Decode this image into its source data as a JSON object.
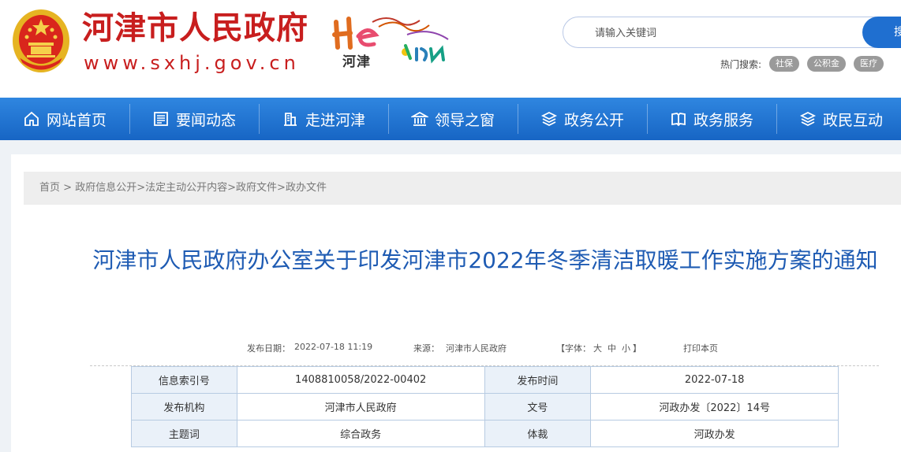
{
  "header": {
    "site_title": "河津市人民政府",
    "site_url": "www.sxhj.gov.cn",
    "logo_caption": "河津",
    "logo_wordmark": "HeJIN",
    "search": {
      "placeholder": "请输入关键词",
      "button_label": "搜索"
    },
    "hot_search": {
      "label": "热门搜索:",
      "tags": [
        "社保",
        "公积金",
        "医疗"
      ]
    }
  },
  "nav": {
    "items": [
      {
        "label": "网站首页",
        "icon": "home-icon"
      },
      {
        "label": "要闻动态",
        "icon": "news-icon"
      },
      {
        "label": "走进河津",
        "icon": "building-icon"
      },
      {
        "label": "领导之窗",
        "icon": "government-building-icon"
      },
      {
        "label": "政务公开",
        "icon": "layers-icon"
      },
      {
        "label": "政务服务",
        "icon": "service-book-icon"
      },
      {
        "label": "政民互动",
        "icon": "layers-icon"
      }
    ]
  },
  "breadcrumb": {
    "items": [
      "首页",
      "政府信息公开",
      "法定主动公开内容",
      "政府文件",
      "政办文件"
    ],
    "sep_first": " > ",
    "sep": ">"
  },
  "article": {
    "title": "河津市人民政府办公室关于印发河津市2022年冬季清洁取暖工作实施方案的通知",
    "meta": {
      "date_label": "发布日期：",
      "date_value": "2022-07-18 11:19",
      "source_label": "来源：",
      "source_value": "河津市人民政府",
      "font_label": "【字体：",
      "font_large": "大",
      "font_medium": "中",
      "font_small": "小",
      "font_close": "】",
      "print_label": "打印本页"
    }
  },
  "info_table": {
    "rows": [
      {
        "label1": "信息索引号",
        "value1": "1408810058/2022-00402",
        "label2": "发布时间",
        "value2": "2022-07-18"
      },
      {
        "label1": "发布机构",
        "value1": "河津市人民政府",
        "label2": "文号",
        "value2": "河政办发〔2022〕14号"
      },
      {
        "label1": "主题词",
        "value1": "综合政务",
        "label2": "体裁",
        "value2": "河政办发"
      }
    ]
  },
  "colors": {
    "brand_red": "#c81e1e",
    "nav_blue": "#1f6fd0",
    "title_blue": "#1e5bb3"
  }
}
